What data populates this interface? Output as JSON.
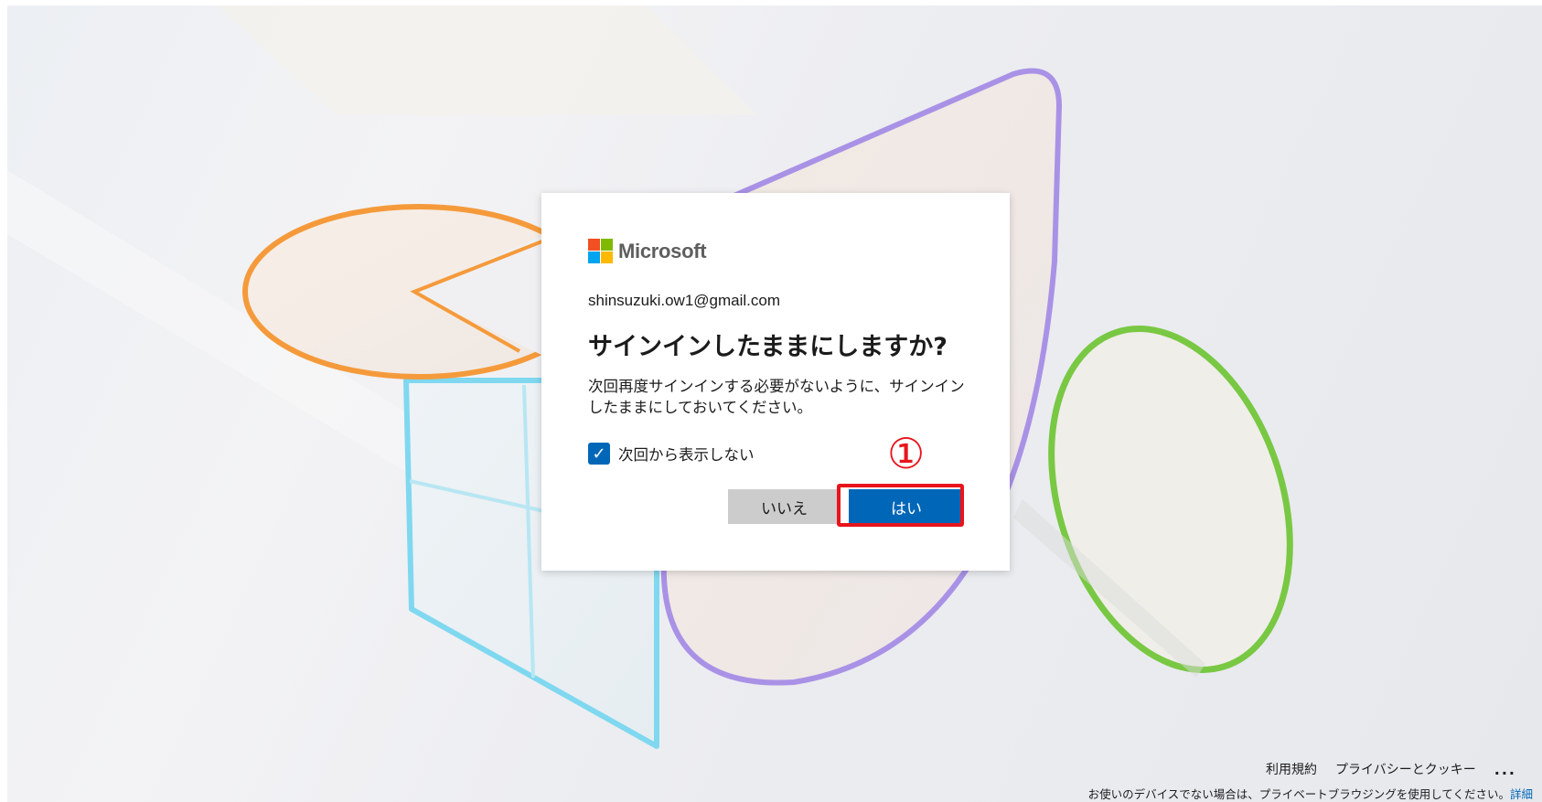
{
  "brand": {
    "name": "Microsoft",
    "logo_colors": [
      "#f25022",
      "#7fba00",
      "#00a4ef",
      "#ffb900"
    ]
  },
  "dialog": {
    "email": "shinsuzuki.ow1@gmail.com",
    "title": "サインインしたままにしますか?",
    "description": "次回再度サインインする必要がないように、サインインしたままにしておいてください。",
    "checkbox": {
      "label": "次回から表示しない",
      "checked": true
    },
    "buttons": {
      "no_label": "いいえ",
      "yes_label": "はい"
    }
  },
  "annotation": {
    "marker": "①",
    "color": "#e8141c"
  },
  "footer": {
    "links": [
      "利用規約",
      "プライバシーとクッキー"
    ],
    "more_label": "...",
    "note": "お使いのデバイスでない場合は、プライベートブラウジングを使用してください。",
    "note_link": "詳細"
  },
  "colors": {
    "accent": "#0067b8",
    "secondary_button": "#cccccc"
  }
}
